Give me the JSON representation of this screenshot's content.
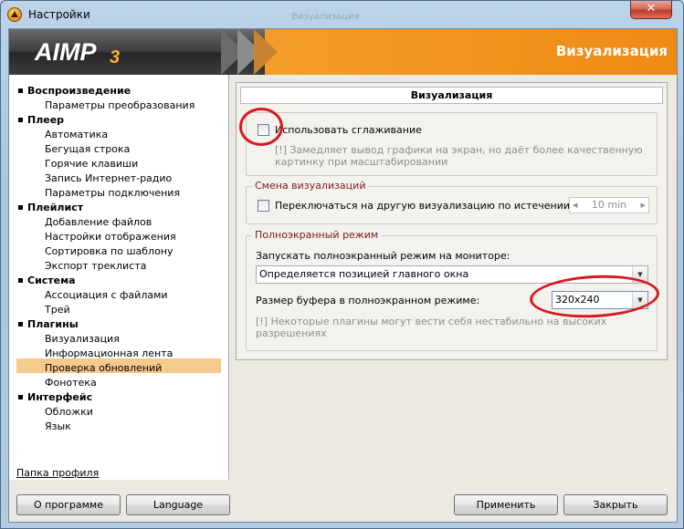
{
  "window": {
    "title": "Настройки",
    "ghost_title": "Визуализация",
    "close_symbol": "✕"
  },
  "header": {
    "logo": "AIMP",
    "logo_version": "3",
    "title": "Визуализация"
  },
  "sidebar": {
    "groups": [
      {
        "label": "Воспроизведение",
        "items": [
          "Параметры преобразования"
        ]
      },
      {
        "label": "Плеер",
        "items": [
          "Автоматика",
          "Бегущая строка",
          "Горячие клавиши",
          "Запись Интернет-радио",
          "Параметры подключения"
        ]
      },
      {
        "label": "Плейлист",
        "items": [
          "Добавление файлов",
          "Настройки отображения",
          "Сортировка по шаблону",
          "Экспорт треклиста"
        ]
      },
      {
        "label": "Система",
        "items": [
          "Ассоциация с файлами",
          "Трей"
        ]
      },
      {
        "label": "Плагины",
        "items": [
          "Визуализация",
          "Информационная лента",
          "Проверка обновлений",
          "Фонотека"
        ]
      },
      {
        "label": "Интерфейс",
        "items": [
          "Обложки",
          "Язык"
        ]
      }
    ],
    "selected": "Визуализация",
    "profile_link": "Папка профиля"
  },
  "content": {
    "section_title": "Визуализация",
    "smoothing": {
      "label": "Использовать сглаживание",
      "checked": false,
      "hint": "[!] Замедляет вывод графики на экран, но даёт более качественную картинку при масштабировании"
    },
    "switch_group": {
      "legend": "Смена визуализаций",
      "checkbox_label": "Переключаться на другую визуализацию по истечении:",
      "checked": false,
      "interval_value": "10 min"
    },
    "fullscreen_group": {
      "legend": "Полноэкранный режим",
      "monitor_label": "Запускать полноэкранный режим на мониторе:",
      "monitor_value": "Определяется позицией главного окна",
      "buffer_label": "Размер буфера в полноэкранном режиме:",
      "buffer_value": "320x240",
      "hint": "[!] Некоторые плагины могут вести себя нестабильно на высоких разрешениях"
    }
  },
  "footer": {
    "about": "О программе",
    "language": "Language",
    "apply": "Применить",
    "close": "Закрыть"
  },
  "icons": {
    "spin_left": "◂",
    "spin_right": "▸",
    "dropdown": "▼"
  }
}
